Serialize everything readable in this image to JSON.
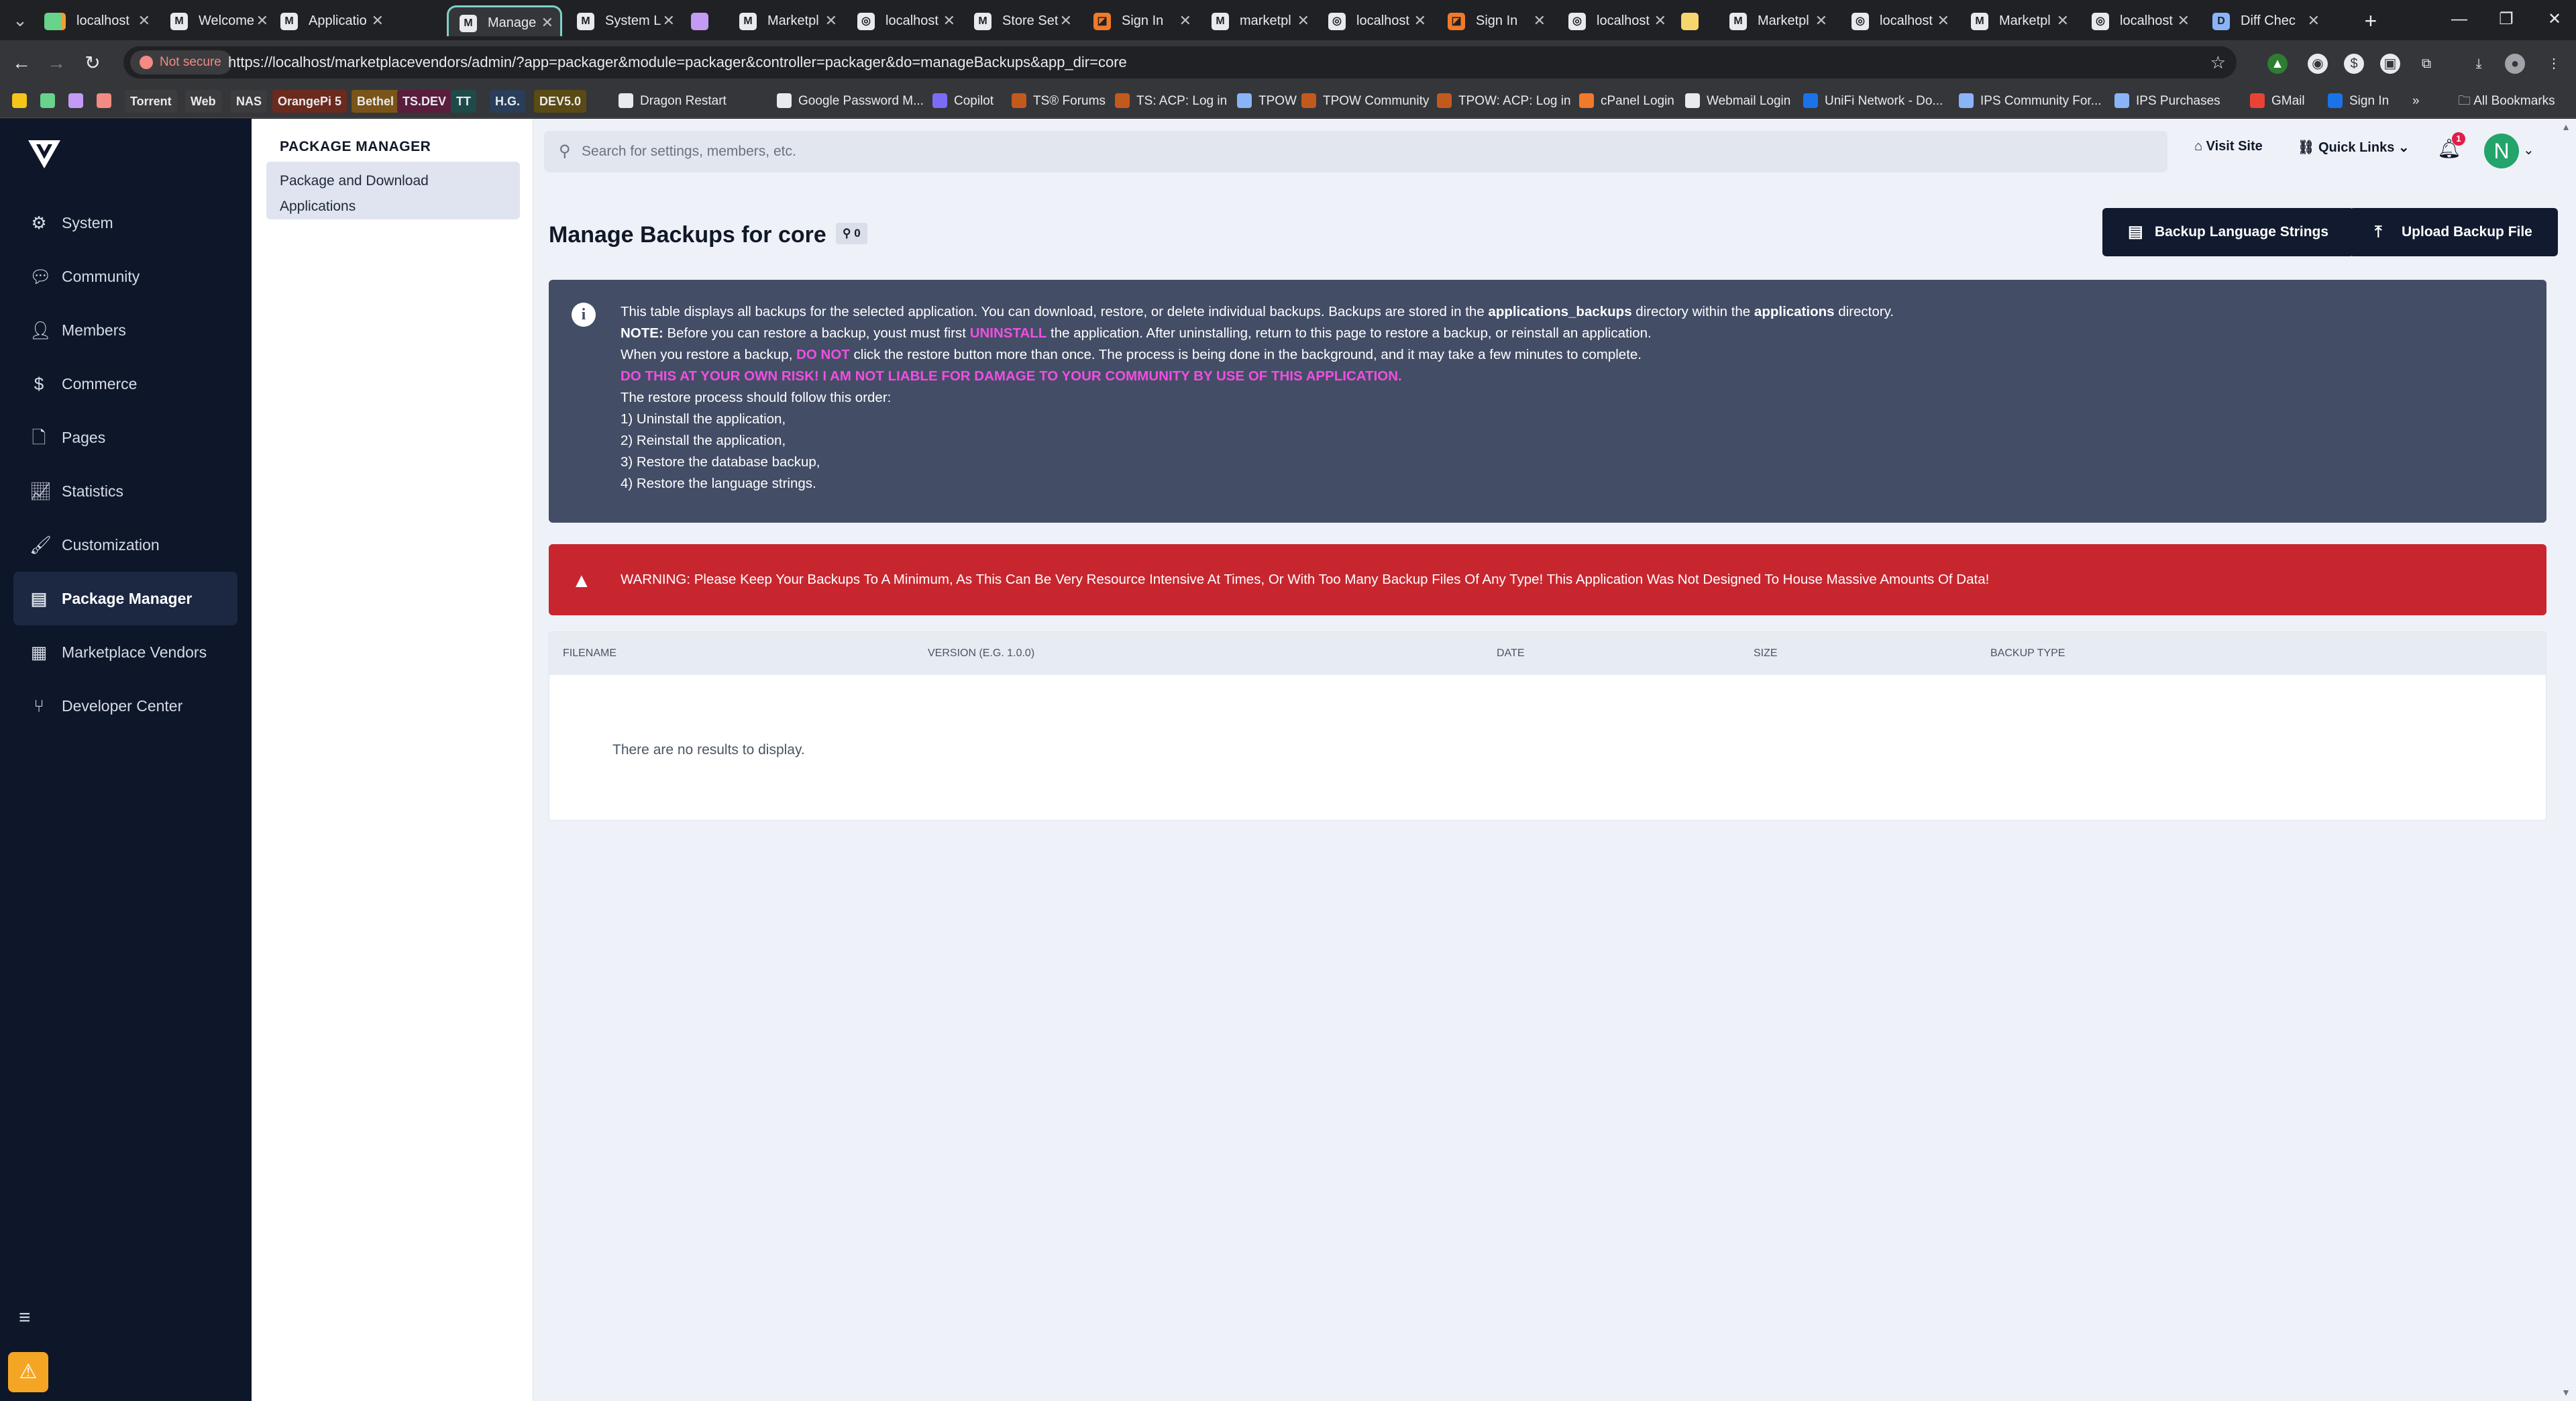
{
  "browser": {
    "tabs": [
      {
        "label": "localhost",
        "fav": "M",
        "color": "#f0a030"
      },
      {
        "label": "",
        "fav": "",
        "color": "#67d38b"
      },
      {
        "label": "Welcome",
        "fav": "M",
        "color": "#e8eaed"
      },
      {
        "label": "Applicatio",
        "fav": "M",
        "color": "#e8eaed"
      },
      {
        "label": "Manage",
        "fav": "M",
        "color": "#e8eaed"
      },
      {
        "label": "System L",
        "fav": "M",
        "color": "#e8eaed"
      },
      {
        "label": "",
        "fav": "",
        "color": "#c39bf5"
      },
      {
        "label": "Marketpl",
        "fav": "M",
        "color": "#e8eaed"
      },
      {
        "label": "localhost",
        "fav": "◎",
        "color": "#e8eaed"
      },
      {
        "label": "Store Set",
        "fav": "M",
        "color": "#e8eaed"
      },
      {
        "label": "Sign In",
        "fav": "◪",
        "color": "#f07a2a"
      },
      {
        "label": "marketpl",
        "fav": "M",
        "color": "#e8eaed"
      },
      {
        "label": "localhost",
        "fav": "◎",
        "color": "#e8eaed"
      },
      {
        "label": "Sign In",
        "fav": "◪",
        "color": "#f07a2a"
      },
      {
        "label": "localhost",
        "fav": "◎",
        "color": "#e8eaed"
      },
      {
        "label": "",
        "fav": "",
        "color": "#f5d76e"
      },
      {
        "label": "Marketpl",
        "fav": "M",
        "color": "#e8eaed"
      },
      {
        "label": "localhost",
        "fav": "◎",
        "color": "#e8eaed"
      },
      {
        "label": "Marketpl",
        "fav": "M",
        "color": "#e8eaed"
      },
      {
        "label": "localhost",
        "fav": "◎",
        "color": "#e8eaed"
      },
      {
        "label": "Diff Chec",
        "fav": "D",
        "color": "#8ab4f8"
      }
    ],
    "not_secure_label": "Not secure",
    "url": "https://localhost/marketplacevendors/admin/?app=packager&module=packager&controller=packager&do=manageBackups&app_dir=core",
    "bookmarks": [
      {
        "label": "Torrent",
        "tag": true,
        "bg": "#3c3c3f"
      },
      {
        "label": "Web",
        "tag": true,
        "bg": "#3c3c3f"
      },
      {
        "label": "NAS",
        "tag": true,
        "bg": "#3c3c3f"
      },
      {
        "label": "OrangePi 5",
        "tag": true,
        "bg": "#6b2a1e"
      },
      {
        "label": "Bethel",
        "tag": true,
        "bg": "#7a5418"
      },
      {
        "label": "TS.DEV",
        "tag": true,
        "bg": "#5a1e3c"
      },
      {
        "label": "TT",
        "tag": true,
        "bg": "#1e4a4a"
      },
      {
        "label": "H.G.",
        "tag": true,
        "bg": "#2a3e5a"
      },
      {
        "label": "DEV5.0",
        "tag": true,
        "bg": "#5a4a14"
      },
      {
        "label": "Dragon Restart",
        "tag": false,
        "bg": "#e8eaed"
      },
      {
        "label": "Google Password M...",
        "tag": false,
        "bg": "#e8eaed"
      },
      {
        "label": "Copilot",
        "tag": false,
        "bg": "#7b6cf5"
      },
      {
        "label": "TS® Forums",
        "tag": false,
        "bg": "#c25a1e"
      },
      {
        "label": "TS: ACP: Log in",
        "tag": false,
        "bg": "#c25a1e"
      },
      {
        "label": "TPOW",
        "tag": false,
        "bg": "#8ab4f8"
      },
      {
        "label": "TPOW Community",
        "tag": false,
        "bg": "#c25a1e"
      },
      {
        "label": "TPOW: ACP: Log in",
        "tag": false,
        "bg": "#c25a1e"
      },
      {
        "label": "cPanel Login",
        "tag": false,
        "bg": "#f07a2a"
      },
      {
        "label": "Webmail Login",
        "tag": false,
        "bg": "#e8eaed"
      },
      {
        "label": "UniFi Network - Do...",
        "tag": false,
        "bg": "#1a73e8"
      },
      {
        "label": "IPS Community For...",
        "tag": false,
        "bg": "#8ab4f8"
      },
      {
        "label": "IPS Purchases",
        "tag": false,
        "bg": "#8ab4f8"
      },
      {
        "label": "GMail",
        "tag": false,
        "bg": "#ea4335"
      },
      {
        "label": "Sign In",
        "tag": false,
        "bg": "#1a73e8"
      }
    ],
    "all_bookmarks_label": "All Bookmarks"
  },
  "sidebar": {
    "items": [
      {
        "label": "System",
        "icon": "cogs-icon"
      },
      {
        "label": "Community",
        "icon": "comments-icon"
      },
      {
        "label": "Members",
        "icon": "user-icon"
      },
      {
        "label": "Commerce",
        "icon": "dollar-icon"
      },
      {
        "label": "Pages",
        "icon": "file-icon"
      },
      {
        "label": "Statistics",
        "icon": "chart-icon"
      },
      {
        "label": "Customization",
        "icon": "paintbrush-icon"
      },
      {
        "label": "Package Manager",
        "icon": "archive-icon"
      },
      {
        "label": "Marketplace Vendors",
        "icon": "store-icon"
      },
      {
        "label": "Developer Center",
        "icon": "code-branch-icon"
      }
    ],
    "active": "Package Manager"
  },
  "subnav": {
    "title": "PACKAGE MANAGER",
    "item": "Package and Download Applications"
  },
  "topbar": {
    "search_placeholder": "Search for settings, members, etc.",
    "visit_site": "Visit Site",
    "quick_links": "Quick Links",
    "notifications_count": "1",
    "avatar_initial": "N"
  },
  "main": {
    "title": "Manage Backups for core",
    "count": "0",
    "btn_lang": "Backup Language Strings",
    "btn_upload": "Upload Backup File",
    "info": {
      "l1_a": "This table displays all backups for the selected application. You can download, restore, or delete individual backups. Backups are stored in the ",
      "l1_b": "applications_backups",
      "l1_c": " directory within the ",
      "l1_d": "applications",
      "l1_e": " directory.",
      "l2_a": "NOTE:",
      "l2_b": " Before you can restore a backup, youst must first ",
      "l2_c": "UNINSTALL",
      "l2_d": " the application. After uninstalling, return to this page to restore a backup, or reinstall an application.",
      "l3_a": "When you restore a backup, ",
      "l3_b": "DO NOT",
      "l3_c": " click the restore button more than once. The process is being done in the background, and it may take a few minutes to complete.",
      "l4": "DO THIS AT YOUR OWN RISK! I AM NOT LIABLE FOR DAMAGE TO YOUR COMMUNITY BY USE OF THIS APPLICATION.",
      "l5": "The restore process should follow this order:",
      "steps": [
        "1) Uninstall the application,",
        "2) Reinstall the application,",
        "3) Restore the database backup,",
        "4) Restore the language strings."
      ]
    },
    "warning": "WARNING: Please Keep Your Backups To A Minimum, As This Can Be Very Resource Intensive At Times, Or With Too Many Backup Files Of Any Type! This Application Was Not Designed To House Massive Amounts Of Data!",
    "table": {
      "columns": [
        "Filename",
        "Version (e.g. 1.0.0)",
        "Date",
        "Size",
        "Backup Type"
      ],
      "empty": "There are no results to display."
    }
  }
}
